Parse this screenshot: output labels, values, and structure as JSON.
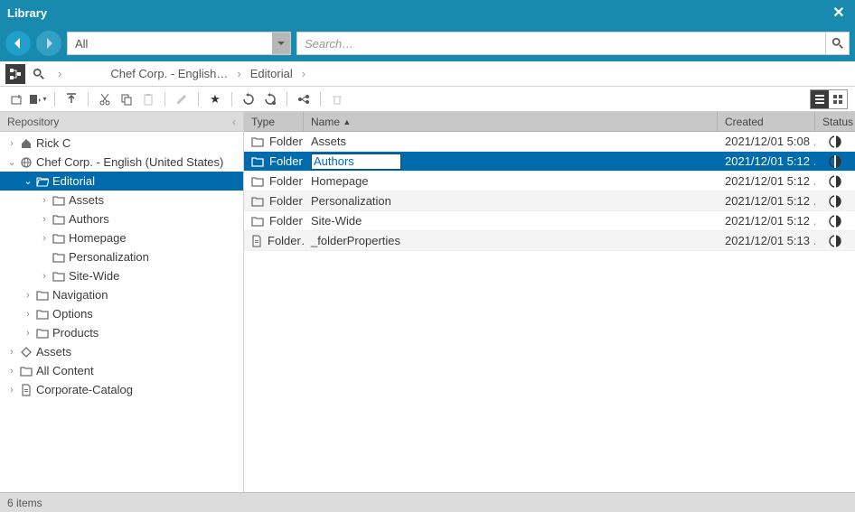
{
  "title": "Library",
  "nav": {
    "filterLabel": "All",
    "searchPlaceholder": "Search…"
  },
  "breadcrumbs": [
    "Chef Corp. - English…",
    "Editorial"
  ],
  "sidebar": {
    "header": "Repository"
  },
  "tree": [
    {
      "depth": 0,
      "exp": ">",
      "icon": "home",
      "label": "Rick C"
    },
    {
      "depth": 0,
      "exp": "v",
      "icon": "globe",
      "label": "Chef Corp. - English (United States)"
    },
    {
      "depth": 1,
      "exp": "v",
      "icon": "folder-open",
      "label": "Editorial",
      "selected": true
    },
    {
      "depth": 2,
      "exp": ">",
      "icon": "folder",
      "label": "Assets"
    },
    {
      "depth": 2,
      "exp": ">",
      "icon": "folder",
      "label": "Authors"
    },
    {
      "depth": 2,
      "exp": ">",
      "icon": "folder",
      "label": "Homepage"
    },
    {
      "depth": 2,
      "exp": "",
      "icon": "folder",
      "label": "Personalization"
    },
    {
      "depth": 2,
      "exp": ">",
      "icon": "folder",
      "label": "Site-Wide"
    },
    {
      "depth": 1,
      "exp": ">",
      "icon": "folder",
      "label": "Navigation"
    },
    {
      "depth": 1,
      "exp": ">",
      "icon": "folder",
      "label": "Options"
    },
    {
      "depth": 1,
      "exp": ">",
      "icon": "folder",
      "label": "Products"
    },
    {
      "depth": 0,
      "exp": ">",
      "icon": "diamond",
      "label": "Assets"
    },
    {
      "depth": 0,
      "exp": ">",
      "icon": "folder",
      "label": "All Content"
    },
    {
      "depth": 0,
      "exp": ">",
      "icon": "doc",
      "label": "Corporate-Catalog"
    }
  ],
  "columns": {
    "type": "Type",
    "name": "Name",
    "created": "Created",
    "status": "Status"
  },
  "rows": [
    {
      "type": "Folder",
      "icon": "folder",
      "name": "Assets",
      "created": "2021/12/01 5:08 …"
    },
    {
      "type": "Folder",
      "icon": "folder",
      "name": "Authors",
      "created": "2021/12/01 5:12 …",
      "selected": true,
      "editing": true
    },
    {
      "type": "Folder",
      "icon": "folder",
      "name": "Homepage",
      "created": "2021/12/01 5:12 …"
    },
    {
      "type": "Folder",
      "icon": "folder",
      "name": "Personalization",
      "created": "2021/12/01 5:12 …"
    },
    {
      "type": "Folder",
      "icon": "folder",
      "name": "Site-Wide",
      "created": "2021/12/01 5:12 …"
    },
    {
      "type": "Folder…",
      "icon": "doc",
      "name": "_folderProperties",
      "created": "2021/12/01 5:13 …"
    }
  ],
  "status": "6 items"
}
